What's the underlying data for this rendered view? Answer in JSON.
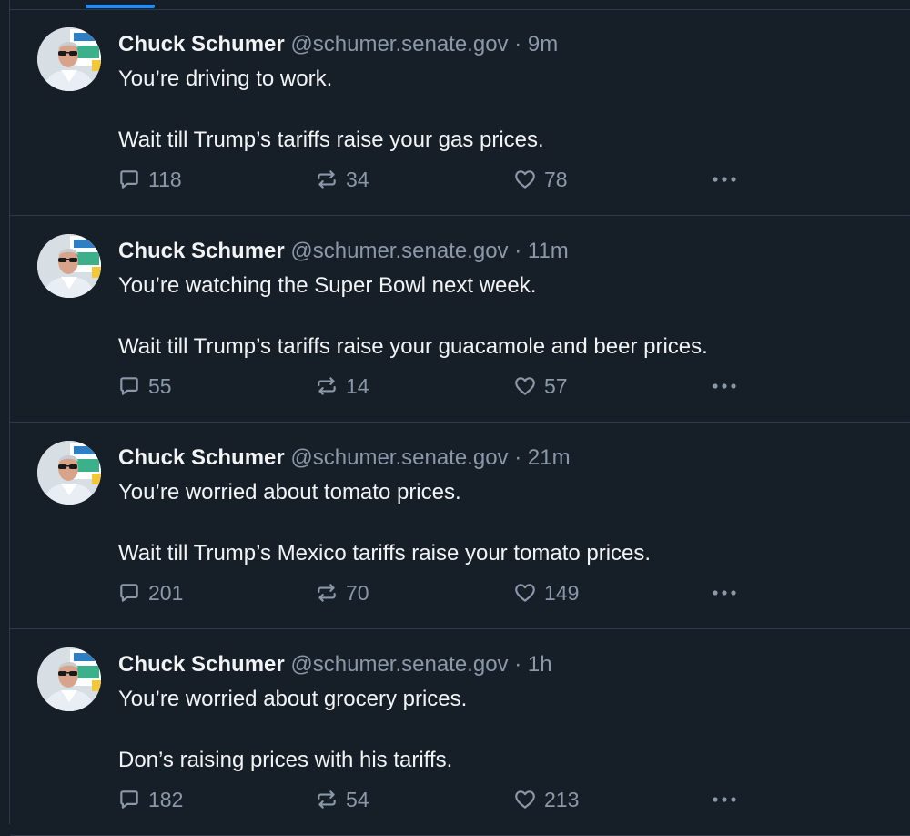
{
  "feed": {
    "posts": [
      {
        "author": "Chuck Schumer",
        "handle": "@schumer.senate.gov",
        "separator": "·",
        "time": "9m",
        "line1": "You’re driving to work.",
        "line2": "Wait till Trump’s tariffs raise your gas prices.",
        "replies": "118",
        "reposts": "34",
        "likes": "78"
      },
      {
        "author": "Chuck Schumer",
        "handle": "@schumer.senate.gov",
        "separator": "·",
        "time": "11m",
        "line1": "You’re watching the Super Bowl next week.",
        "line2": "Wait till Trump’s tariffs raise your guacamole and beer prices.",
        "replies": "55",
        "reposts": "14",
        "likes": "57"
      },
      {
        "author": "Chuck Schumer",
        "handle": "@schumer.senate.gov",
        "separator": "·",
        "time": "21m",
        "line1": "You’re worried about tomato prices.",
        "line2": "Wait till Trump’s Mexico tariffs raise your tomato prices.",
        "replies": "201",
        "reposts": "70",
        "likes": "149"
      },
      {
        "author": "Chuck Schumer",
        "handle": "@schumer.senate.gov",
        "separator": "·",
        "time": "1h",
        "line1": "You’re worried about grocery prices.",
        "line2": "Don’s raising prices with his tariffs.",
        "replies": "182",
        "reposts": "54",
        "likes": "213"
      }
    ]
  },
  "icons": {
    "reply": "reply-icon",
    "repost": "repost-icon",
    "like": "heart-icon",
    "more": "more-options-icon"
  },
  "colors": {
    "background": "#161e27",
    "text": "#f1f3f5",
    "muted": "#8b98a9",
    "border": "#2e3a49",
    "accent": "#208bfe"
  }
}
